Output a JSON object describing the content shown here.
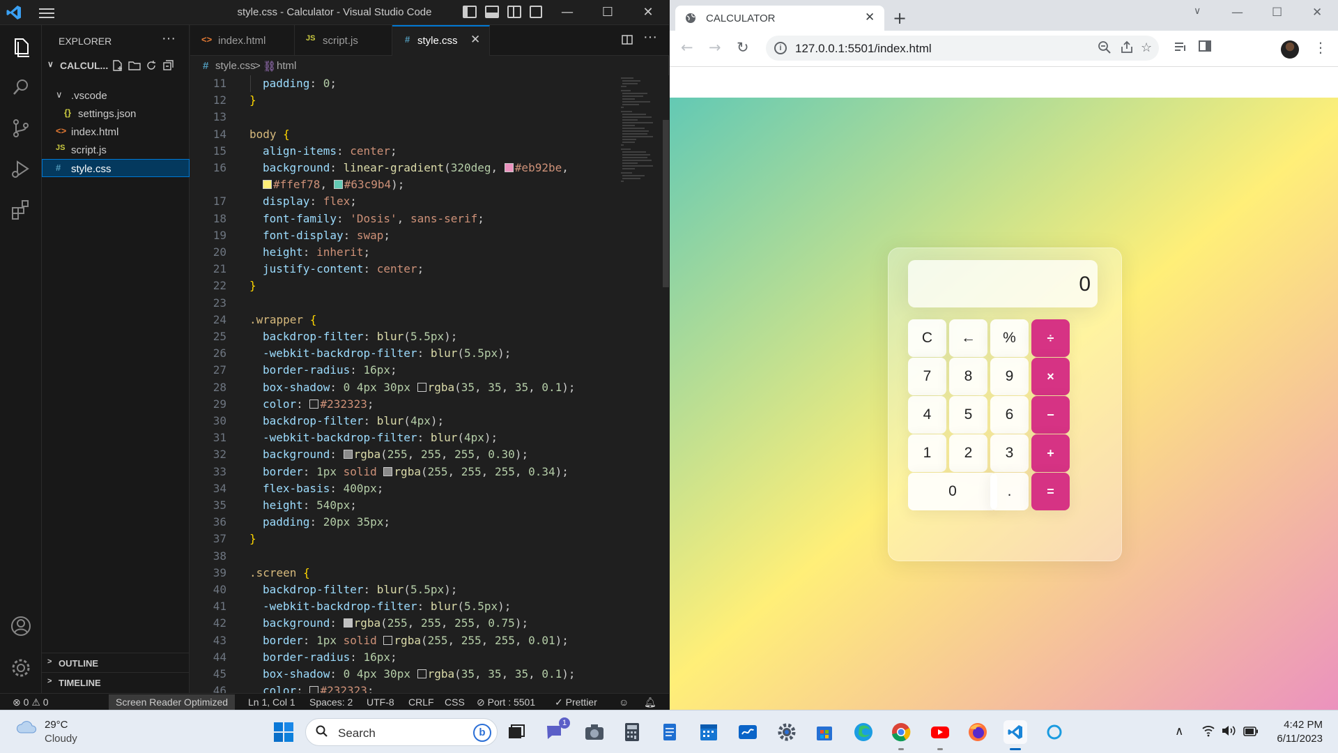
{
  "vscode": {
    "window_title": "style.css - Calculator - Visual Studio Code",
    "explorer": {
      "header": "EXPLORER",
      "root_folder": "CALCUL...",
      "tree": [
        {
          "label": ".vscode",
          "icon": "chevron-down-icon"
        },
        {
          "label": "settings.json",
          "icon": "{}"
        },
        {
          "label": "index.html",
          "icon": "<>"
        },
        {
          "label": "script.js",
          "icon": "JS"
        },
        {
          "label": "style.css",
          "icon": "#"
        }
      ],
      "outline": "OUTLINE",
      "timeline": "TIMELINE"
    },
    "tabs": [
      {
        "label": "index.html",
        "icon": "<>",
        "color": "#e37933"
      },
      {
        "label": "script.js",
        "icon": "JS",
        "color": "#cbcb41"
      },
      {
        "label": "style.css",
        "icon": "#",
        "color": "#519aba",
        "active": true
      }
    ],
    "breadcrumb": {
      "file": "style.css",
      "separator": ">",
      "node": "html"
    },
    "status": {
      "errors": "0",
      "warnings": "0",
      "screen_reader": "Screen Reader Optimized",
      "position": "Ln 1, Col 1",
      "spaces": "Spaces: 2",
      "encoding": "UTF-8",
      "eol": "CRLF",
      "language": "CSS",
      "port": "Port : 5501",
      "prettier": "Prettier"
    },
    "code_lines": [
      {
        "n": "11",
        "indent": true,
        "parts": [
          [
            "prop",
            "padding"
          ],
          [
            "p",
            ": "
          ],
          [
            "num",
            "0"
          ],
          [
            "p",
            ";"
          ]
        ]
      },
      {
        "n": "12",
        "parts": [
          [
            "brace",
            "}"
          ]
        ]
      },
      {
        "n": "13",
        "parts": []
      },
      {
        "n": "14",
        "parts": [
          [
            "sel",
            "body"
          ],
          [
            "p",
            " "
          ],
          [
            "brace",
            "{"
          ]
        ]
      },
      {
        "n": "15",
        "indent": true,
        "parts": [
          [
            "prop",
            "align-items"
          ],
          [
            "p",
            ": "
          ],
          [
            "val",
            "center"
          ],
          [
            "p",
            ";"
          ]
        ]
      },
      {
        "n": "16",
        "indent": true,
        "parts": [
          [
            "prop",
            "background"
          ],
          [
            "p",
            ": "
          ],
          [
            "fn",
            "linear-gradient"
          ],
          [
            "p",
            "("
          ],
          [
            "num",
            "320deg"
          ],
          [
            "p",
            ", "
          ],
          [
            "sw",
            "#eb92be"
          ],
          [
            "val",
            "#eb92be"
          ],
          [
            "p",
            ","
          ]
        ]
      },
      {
        "n": "",
        "indent": true,
        "wrap": true,
        "parts": [
          [
            "sw",
            "#ffef78"
          ],
          [
            "val",
            "#ffef78"
          ],
          [
            "p",
            ", "
          ],
          [
            "sw",
            "#63c9b4"
          ],
          [
            "val",
            "#63c9b4"
          ],
          [
            "p",
            ");"
          ]
        ]
      },
      {
        "n": "17",
        "indent": true,
        "parts": [
          [
            "prop",
            "display"
          ],
          [
            "p",
            ": "
          ],
          [
            "val",
            "flex"
          ],
          [
            "p",
            ";"
          ]
        ]
      },
      {
        "n": "18",
        "indent": true,
        "parts": [
          [
            "prop",
            "font-family"
          ],
          [
            "p",
            ": "
          ],
          [
            "val",
            "'Dosis'"
          ],
          [
            "p",
            ", "
          ],
          [
            "val",
            "sans-serif"
          ],
          [
            "p",
            ";"
          ]
        ]
      },
      {
        "n": "19",
        "indent": true,
        "parts": [
          [
            "prop",
            "font-display"
          ],
          [
            "p",
            ": "
          ],
          [
            "val",
            "swap"
          ],
          [
            "p",
            ";"
          ]
        ]
      },
      {
        "n": "20",
        "indent": true,
        "parts": [
          [
            "prop",
            "height"
          ],
          [
            "p",
            ": "
          ],
          [
            "val",
            "inherit"
          ],
          [
            "p",
            ";"
          ]
        ]
      },
      {
        "n": "21",
        "indent": true,
        "parts": [
          [
            "prop",
            "justify-content"
          ],
          [
            "p",
            ": "
          ],
          [
            "val",
            "center"
          ],
          [
            "p",
            ";"
          ]
        ]
      },
      {
        "n": "22",
        "parts": [
          [
            "brace",
            "}"
          ]
        ]
      },
      {
        "n": "23",
        "parts": []
      },
      {
        "n": "24",
        "parts": [
          [
            "sel",
            ".wrapper"
          ],
          [
            "p",
            " "
          ],
          [
            "brace",
            "{"
          ]
        ]
      },
      {
        "n": "25",
        "indent": true,
        "parts": [
          [
            "prop",
            "backdrop-filter"
          ],
          [
            "p",
            ": "
          ],
          [
            "fn",
            "blur"
          ],
          [
            "p",
            "("
          ],
          [
            "num",
            "5.5px"
          ],
          [
            "p",
            ");"
          ]
        ]
      },
      {
        "n": "26",
        "indent": true,
        "parts": [
          [
            "prop",
            "-webkit-backdrop-filter"
          ],
          [
            "p",
            ": "
          ],
          [
            "fn",
            "blur"
          ],
          [
            "p",
            "("
          ],
          [
            "num",
            "5.5px"
          ],
          [
            "p",
            ");"
          ]
        ]
      },
      {
        "n": "27",
        "indent": true,
        "parts": [
          [
            "prop",
            "border-radius"
          ],
          [
            "p",
            ": "
          ],
          [
            "num",
            "16px"
          ],
          [
            "p",
            ";"
          ]
        ]
      },
      {
        "n": "28",
        "indent": true,
        "parts": [
          [
            "prop",
            "box-shadow"
          ],
          [
            "p",
            ": "
          ],
          [
            "num",
            "0"
          ],
          [
            "p",
            " "
          ],
          [
            "num",
            "4px"
          ],
          [
            "p",
            " "
          ],
          [
            "num",
            "30px"
          ],
          [
            "p",
            " "
          ],
          [
            "sw",
            "rgba(35,35,35,0.1)"
          ],
          [
            "fn",
            "rgba"
          ],
          [
            "p",
            "("
          ],
          [
            "num",
            "35"
          ],
          [
            "p",
            ", "
          ],
          [
            "num",
            "35"
          ],
          [
            "p",
            ", "
          ],
          [
            "num",
            "35"
          ],
          [
            "p",
            ", "
          ],
          [
            "num",
            "0.1"
          ],
          [
            "p",
            ");"
          ]
        ]
      },
      {
        "n": "29",
        "indent": true,
        "parts": [
          [
            "prop",
            "color"
          ],
          [
            "p",
            ": "
          ],
          [
            "sw",
            "#232323"
          ],
          [
            "val",
            "#232323"
          ],
          [
            "p",
            ";"
          ]
        ]
      },
      {
        "n": "30",
        "indent": true,
        "parts": [
          [
            "prop",
            "backdrop-filter"
          ],
          [
            "p",
            ": "
          ],
          [
            "fn",
            "blur"
          ],
          [
            "p",
            "("
          ],
          [
            "num",
            "4px"
          ],
          [
            "p",
            ");"
          ]
        ]
      },
      {
        "n": "31",
        "indent": true,
        "parts": [
          [
            "prop",
            "-webkit-backdrop-filter"
          ],
          [
            "p",
            ": "
          ],
          [
            "fn",
            "blur"
          ],
          [
            "p",
            "("
          ],
          [
            "num",
            "4px"
          ],
          [
            "p",
            ");"
          ]
        ]
      },
      {
        "n": "32",
        "indent": true,
        "parts": [
          [
            "prop",
            "background"
          ],
          [
            "p",
            ": "
          ],
          [
            "sw",
            "#8a8a8a"
          ],
          [
            "fn",
            "rgba"
          ],
          [
            "p",
            "("
          ],
          [
            "num",
            "255"
          ],
          [
            "p",
            ", "
          ],
          [
            "num",
            "255"
          ],
          [
            "p",
            ", "
          ],
          [
            "num",
            "255"
          ],
          [
            "p",
            ", "
          ],
          [
            "num",
            "0.30"
          ],
          [
            "p",
            ");"
          ]
        ]
      },
      {
        "n": "33",
        "indent": true,
        "parts": [
          [
            "prop",
            "border"
          ],
          [
            "p",
            ": "
          ],
          [
            "num",
            "1px"
          ],
          [
            "p",
            " "
          ],
          [
            "val",
            "solid"
          ],
          [
            "p",
            " "
          ],
          [
            "sw",
            "#8a8a8a"
          ],
          [
            "fn",
            "rgba"
          ],
          [
            "p",
            "("
          ],
          [
            "num",
            "255"
          ],
          [
            "p",
            ", "
          ],
          [
            "num",
            "255"
          ],
          [
            "p",
            ", "
          ],
          [
            "num",
            "255"
          ],
          [
            "p",
            ", "
          ],
          [
            "num",
            "0.34"
          ],
          [
            "p",
            ");"
          ]
        ]
      },
      {
        "n": "34",
        "indent": true,
        "parts": [
          [
            "prop",
            "flex-basis"
          ],
          [
            "p",
            ": "
          ],
          [
            "num",
            "400px"
          ],
          [
            "p",
            ";"
          ]
        ]
      },
      {
        "n": "35",
        "indent": true,
        "parts": [
          [
            "prop",
            "height"
          ],
          [
            "p",
            ": "
          ],
          [
            "num",
            "540px"
          ],
          [
            "p",
            ";"
          ]
        ]
      },
      {
        "n": "36",
        "indent": true,
        "parts": [
          [
            "prop",
            "padding"
          ],
          [
            "p",
            ": "
          ],
          [
            "num",
            "20px"
          ],
          [
            "p",
            " "
          ],
          [
            "num",
            "35px"
          ],
          [
            "p",
            ";"
          ]
        ]
      },
      {
        "n": "37",
        "parts": [
          [
            "brace",
            "}"
          ]
        ]
      },
      {
        "n": "38",
        "parts": []
      },
      {
        "n": "39",
        "parts": [
          [
            "sel",
            ".screen"
          ],
          [
            "p",
            " "
          ],
          [
            "brace",
            "{"
          ]
        ]
      },
      {
        "n": "40",
        "indent": true,
        "parts": [
          [
            "prop",
            "backdrop-filter"
          ],
          [
            "p",
            ": "
          ],
          [
            "fn",
            "blur"
          ],
          [
            "p",
            "("
          ],
          [
            "num",
            "5.5px"
          ],
          [
            "p",
            ");"
          ]
        ]
      },
      {
        "n": "41",
        "indent": true,
        "parts": [
          [
            "prop",
            "-webkit-backdrop-filter"
          ],
          [
            "p",
            ": "
          ],
          [
            "fn",
            "blur"
          ],
          [
            "p",
            "("
          ],
          [
            "num",
            "5.5px"
          ],
          [
            "p",
            ");"
          ]
        ]
      },
      {
        "n": "42",
        "indent": true,
        "parts": [
          [
            "prop",
            "background"
          ],
          [
            "p",
            ": "
          ],
          [
            "sw",
            "#c0c0c0"
          ],
          [
            "fn",
            "rgba"
          ],
          [
            "p",
            "("
          ],
          [
            "num",
            "255"
          ],
          [
            "p",
            ", "
          ],
          [
            "num",
            "255"
          ],
          [
            "p",
            ", "
          ],
          [
            "num",
            "255"
          ],
          [
            "p",
            ", "
          ],
          [
            "num",
            "0.75"
          ],
          [
            "p",
            ");"
          ]
        ]
      },
      {
        "n": "43",
        "indent": true,
        "parts": [
          [
            "prop",
            "border"
          ],
          [
            "p",
            ": "
          ],
          [
            "num",
            "1px"
          ],
          [
            "p",
            " "
          ],
          [
            "val",
            "solid"
          ],
          [
            "p",
            " "
          ],
          [
            "sw",
            "transparent"
          ],
          [
            "fn",
            "rgba"
          ],
          [
            "p",
            "("
          ],
          [
            "num",
            "255"
          ],
          [
            "p",
            ", "
          ],
          [
            "num",
            "255"
          ],
          [
            "p",
            ", "
          ],
          [
            "num",
            "255"
          ],
          [
            "p",
            ", "
          ],
          [
            "num",
            "0.01"
          ],
          [
            "p",
            ");"
          ]
        ]
      },
      {
        "n": "44",
        "indent": true,
        "parts": [
          [
            "prop",
            "border-radius"
          ],
          [
            "p",
            ": "
          ],
          [
            "num",
            "16px"
          ],
          [
            "p",
            ";"
          ]
        ]
      },
      {
        "n": "45",
        "indent": true,
        "parts": [
          [
            "prop",
            "box-shadow"
          ],
          [
            "p",
            ": "
          ],
          [
            "num",
            "0"
          ],
          [
            "p",
            " "
          ],
          [
            "num",
            "4px"
          ],
          [
            "p",
            " "
          ],
          [
            "num",
            "30px"
          ],
          [
            "p",
            " "
          ],
          [
            "sw",
            "rgba(35,35,35,0.1)"
          ],
          [
            "fn",
            "rgba"
          ],
          [
            "p",
            "("
          ],
          [
            "num",
            "35"
          ],
          [
            "p",
            ", "
          ],
          [
            "num",
            "35"
          ],
          [
            "p",
            ", "
          ],
          [
            "num",
            "35"
          ],
          [
            "p",
            ", "
          ],
          [
            "num",
            "0.1"
          ],
          [
            "p",
            ");"
          ]
        ]
      },
      {
        "n": "46",
        "indent": true,
        "parts": [
          [
            "prop",
            "color"
          ],
          [
            "p",
            ": "
          ],
          [
            "sw",
            "#232323"
          ],
          [
            "val",
            "#232323"
          ],
          [
            "p",
            ";"
          ]
        ]
      }
    ]
  },
  "chrome": {
    "tab_title": "CALCULATOR",
    "url": "127.0.0.1:5501/index.html",
    "calculator": {
      "display": "0",
      "keys": [
        [
          {
            "label": "C"
          },
          {
            "label": "←"
          },
          {
            "label": "%"
          },
          {
            "label": "÷",
            "op": true
          }
        ],
        [
          {
            "label": "7"
          },
          {
            "label": "8"
          },
          {
            "label": "9"
          },
          {
            "label": "×",
            "op": true
          }
        ],
        [
          {
            "label": "4"
          },
          {
            "label": "5"
          },
          {
            "label": "6"
          },
          {
            "label": "−",
            "op": true
          }
        ],
        [
          {
            "label": "1"
          },
          {
            "label": "2"
          },
          {
            "label": "3"
          },
          {
            "label": "+",
            "op": true
          }
        ],
        [
          {
            "label": "0",
            "wide": true
          },
          {
            "label": "."
          },
          {
            "label": "=",
            "op": true
          }
        ]
      ],
      "accent": "#d63384"
    }
  },
  "taskbar": {
    "weather": {
      "temp": "29°C",
      "condition": "Cloudy"
    },
    "search_placeholder": "Search",
    "chat_badge": "1",
    "time": "4:42 PM",
    "date": "6/11/2023"
  }
}
